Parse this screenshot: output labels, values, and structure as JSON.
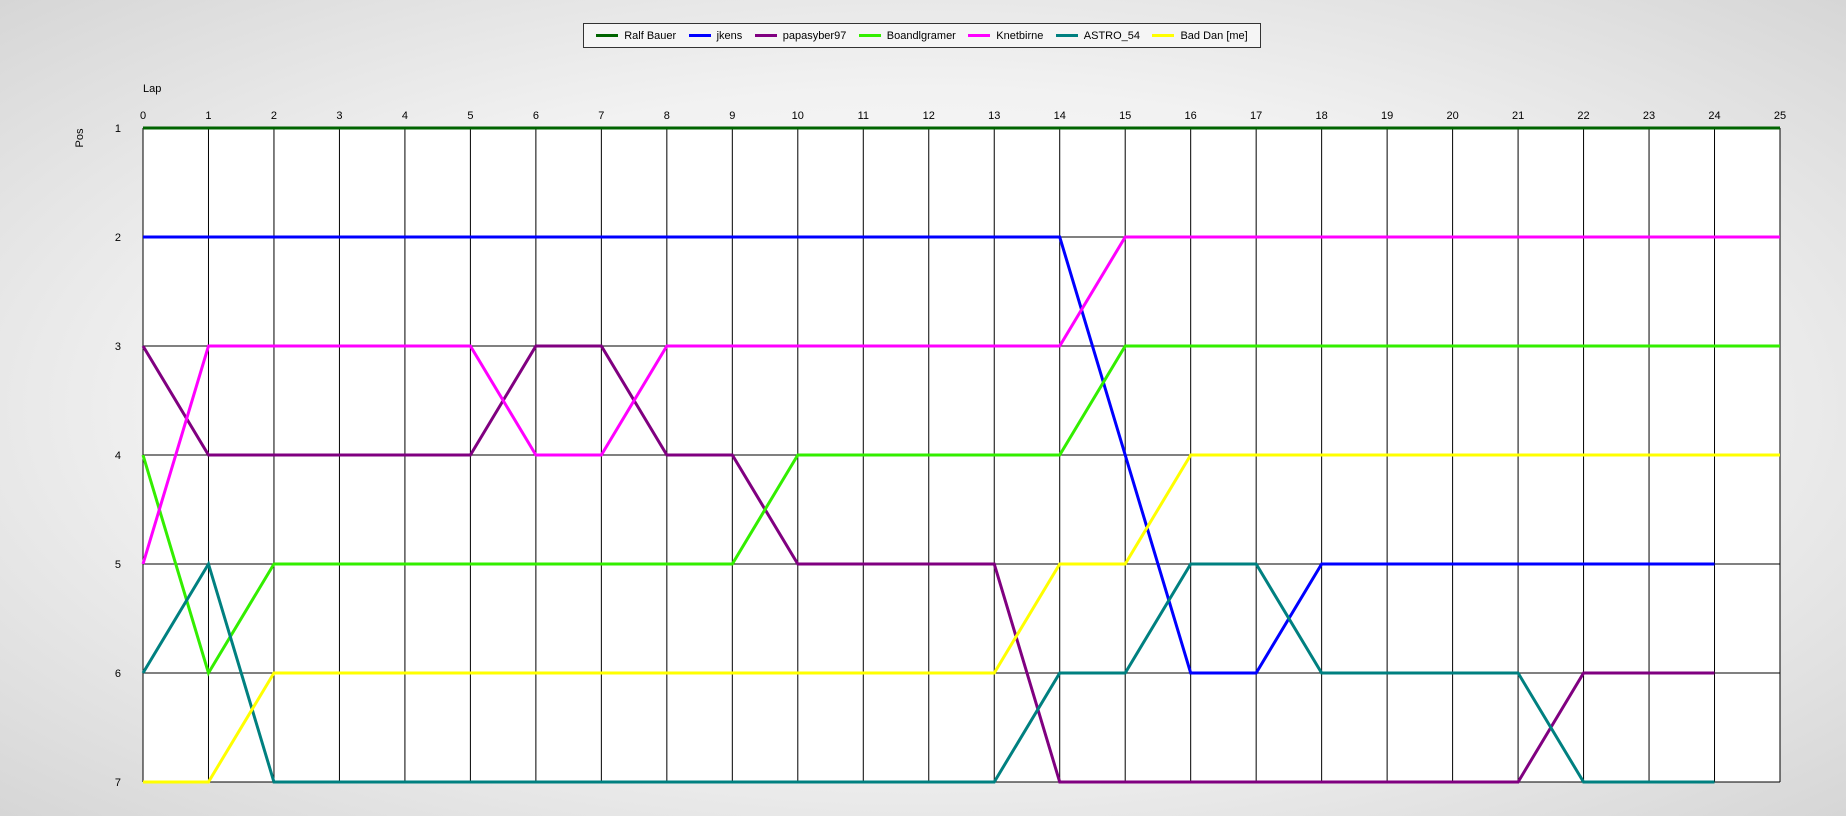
{
  "chart_data": {
    "type": "line",
    "title": "",
    "xlabel": "Lap",
    "ylabel": "Pos",
    "xlim": [
      0,
      25
    ],
    "ylim": [
      1,
      7
    ],
    "y_inverted": true,
    "grid": true,
    "legend_position": "top-center",
    "x": [
      0,
      1,
      2,
      3,
      4,
      5,
      6,
      7,
      8,
      9,
      10,
      11,
      12,
      13,
      14,
      15,
      16,
      17,
      18,
      19,
      20,
      21,
      22,
      23,
      24,
      25
    ],
    "xticks": [
      "0",
      "1",
      "2",
      "3",
      "4",
      "5",
      "6",
      "7",
      "8",
      "9",
      "10",
      "11",
      "12",
      "13",
      "14",
      "15",
      "16",
      "17",
      "18",
      "19",
      "20",
      "21",
      "22",
      "23",
      "24",
      "25"
    ],
    "yticks": [
      "1",
      "2",
      "3",
      "4",
      "5",
      "6",
      "7"
    ],
    "series": [
      {
        "name": "Ralf Bauer",
        "color": "#006400",
        "values": [
          1,
          1,
          1,
          1,
          1,
          1,
          1,
          1,
          1,
          1,
          1,
          1,
          1,
          1,
          1,
          1,
          1,
          1,
          1,
          1,
          1,
          1,
          1,
          1,
          1,
          1
        ]
      },
      {
        "name": "jkens",
        "color": "#0000ff",
        "values": [
          2,
          2,
          2,
          2,
          2,
          2,
          2,
          2,
          2,
          2,
          2,
          2,
          2,
          2,
          2,
          4,
          6,
          6,
          5,
          5,
          5,
          5,
          5,
          5,
          5
        ]
      },
      {
        "name": "papasyber97",
        "color": "#800080",
        "values": [
          3,
          4,
          4,
          4,
          4,
          4,
          3,
          3,
          4,
          4,
          5,
          5,
          5,
          5,
          7,
          7,
          7,
          7,
          7,
          7,
          7,
          7,
          6,
          6,
          6
        ]
      },
      {
        "name": "Boandlgramer",
        "color": "#33ee00",
        "values": [
          4,
          6,
          5,
          5,
          5,
          5,
          5,
          5,
          5,
          5,
          4,
          4,
          4,
          4,
          4,
          3,
          3,
          3,
          3,
          3,
          3,
          3,
          3,
          3,
          3,
          3
        ]
      },
      {
        "name": "Knetbirne",
        "color": "#ff00ff",
        "values": [
          5,
          3,
          3,
          3,
          3,
          3,
          4,
          4,
          3,
          3,
          3,
          3,
          3,
          3,
          3,
          2,
          2,
          2,
          2,
          2,
          2,
          2,
          2,
          2,
          2,
          2
        ]
      },
      {
        "name": "ASTRO_54",
        "color": "#008080",
        "values": [
          6,
          5,
          7,
          7,
          7,
          7,
          7,
          7,
          7,
          7,
          7,
          7,
          7,
          7,
          6,
          6,
          5,
          5,
          6,
          6,
          6,
          6,
          7,
          7,
          7
        ]
      },
      {
        "name": "Bad Dan [me]",
        "color": "#ffff00",
        "values": [
          7,
          7,
          6,
          6,
          6,
          6,
          6,
          6,
          6,
          6,
          6,
          6,
          6,
          6,
          5,
          5,
          4,
          4,
          4,
          4,
          4,
          4,
          4,
          4,
          4,
          4
        ]
      }
    ]
  }
}
